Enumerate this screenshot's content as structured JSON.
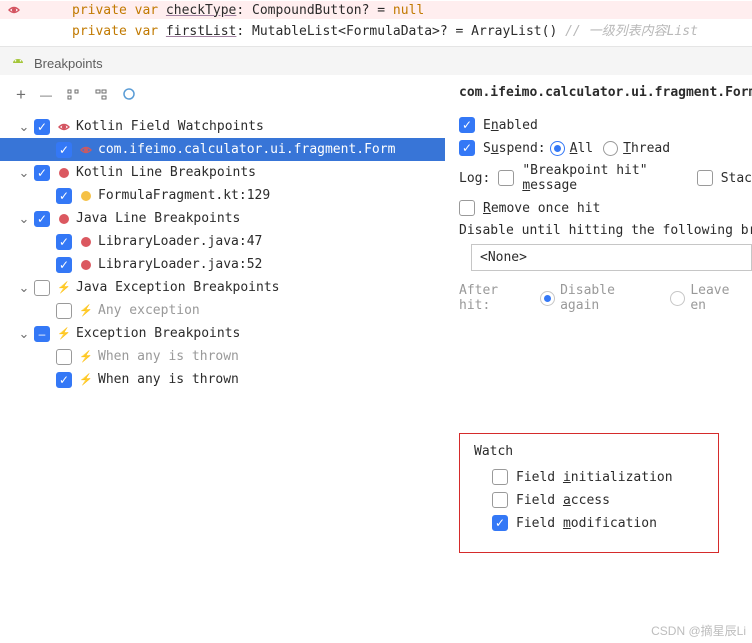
{
  "code": {
    "line1_kw": "private var",
    "line1_name": "checkType",
    "line1_rest": ": CompoundButton? = ",
    "line1_null": "null",
    "line2_kw": "private var",
    "line2_name": "firstList",
    "line2_rest": ": MutableList<FormulaData>? = ArrayList() ",
    "line2_comment": "// 一级列表内容List"
  },
  "panel_title": "Breakpoints",
  "toolbar": {
    "plus": "+",
    "minus": "—"
  },
  "tree": {
    "kotlin_watch": "Kotlin Field Watchpoints",
    "kotlin_watch_item": "com.ifeimo.calculator.ui.fragment.Form",
    "kotlin_line": "Kotlin Line Breakpoints",
    "kotlin_line_item": "FormulaFragment.kt:129",
    "java_line": "Java Line Breakpoints",
    "java_line_item1": "LibraryLoader.java:47",
    "java_line_item2": "LibraryLoader.java:52",
    "java_exc": "Java Exception Breakpoints",
    "java_exc_item": "Any exception",
    "exc_bp": "Exception Breakpoints",
    "exc_item1": "When any is thrown",
    "exc_item2": "When any is thrown"
  },
  "details": {
    "title": "com.ifeimo.calculator.ui.fragment.FormulaF",
    "enabled_pre": "E",
    "enabled_u": "n",
    "enabled_post": "abled",
    "suspend_pre": "S",
    "suspend_u": "u",
    "suspend_post": "spend:",
    "all_u": "A",
    "all_post": "ll",
    "thread_u": "T",
    "thread_post": "hread",
    "log_label": "Log:",
    "log_msg_pre": "\"Breakpoint hit\" ",
    "log_msg_u": "m",
    "log_msg_post": "essage",
    "log_stack": "Stac",
    "remove_u": "R",
    "remove_post": "emove once hit",
    "disable_until": "Disable until hitting the following breakp",
    "none": "<None>",
    "after_hit": "After hit:",
    "disable_again": "Disable again",
    "leave": "Leave en",
    "watch_title": "Watch",
    "field_init_pre": "Field ",
    "field_init_u": "i",
    "field_init_post": "nitialization",
    "field_acc_pre": "Field ",
    "field_acc_u": "a",
    "field_acc_post": "ccess",
    "field_mod_pre": "Field ",
    "field_mod_u": "m",
    "field_mod_post": "odification"
  },
  "watermark": "CSDN @摘星辰Li"
}
